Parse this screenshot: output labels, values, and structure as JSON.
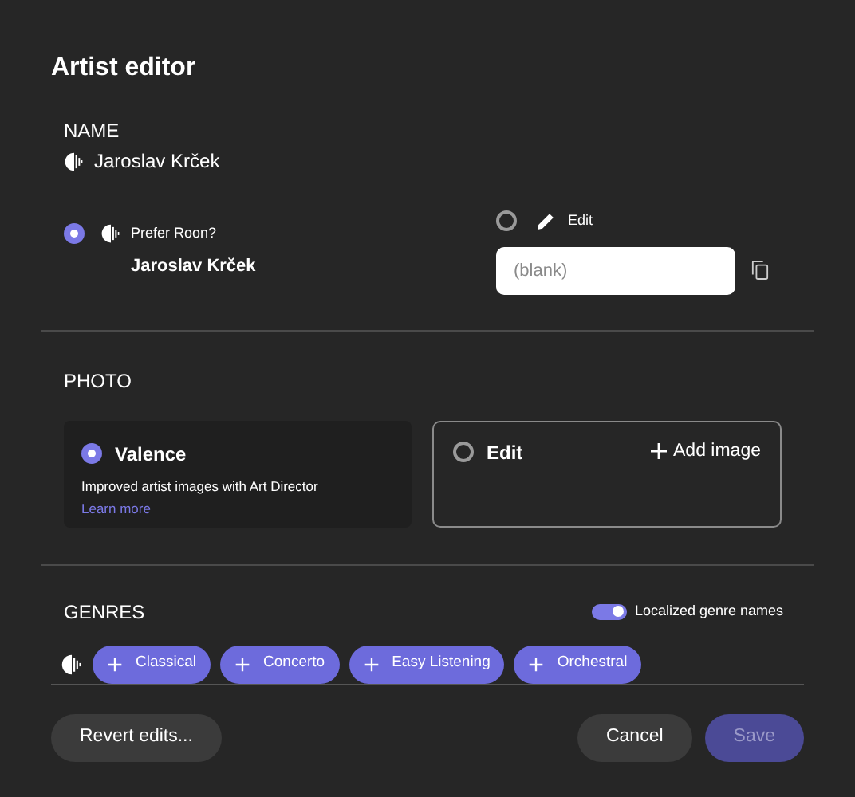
{
  "title": "Artist editor",
  "name": {
    "heading": "NAME",
    "current": "Jaroslav Krček",
    "options": [
      {
        "kind": "roon",
        "label": "Prefer Roon?",
        "value": "Jaroslav Krček",
        "selected": true
      },
      {
        "kind": "edit",
        "label": "Edit",
        "placeholder": "(blank)",
        "selected": false
      }
    ]
  },
  "photo": {
    "heading": "PHOTO",
    "options": [
      {
        "kind": "source",
        "label": "Valence",
        "description": "Improved artist images with Art Director",
        "link": "Learn more",
        "selected": true
      },
      {
        "kind": "edit",
        "label": "Edit",
        "action": "Add image",
        "selected": false
      }
    ]
  },
  "genres": {
    "heading": "GENRES",
    "toggle": {
      "label": "Localized genre names",
      "on": true
    },
    "chips": [
      "Classical",
      "Concerto",
      "Easy Listening",
      "Orchestral"
    ]
  },
  "buttons": [
    {
      "label": "Revert edits...",
      "kind": "secondary",
      "disabled": false
    },
    {
      "label": "Cancel",
      "kind": "secondary",
      "disabled": false
    },
    {
      "label": "Save",
      "kind": "primary",
      "disabled": true
    }
  ]
}
